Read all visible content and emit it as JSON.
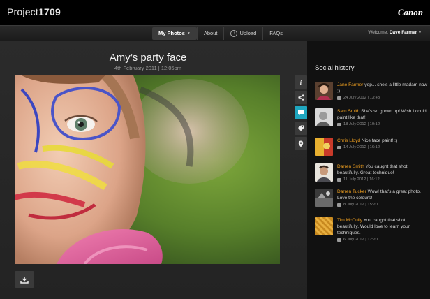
{
  "header": {
    "brand_prefix": "Project",
    "brand_number": "1709",
    "logo_text": "Canon"
  },
  "nav": {
    "items": [
      {
        "label": "My Photos",
        "active": true
      },
      {
        "label": "About"
      },
      {
        "label": "Upload"
      },
      {
        "label": "FAQs"
      }
    ],
    "welcome_prefix": "Welcome,",
    "user_name": "Dave Farmer"
  },
  "photo": {
    "title": "Amy’s party face",
    "date": "4th February 2011 | 12:05pm"
  },
  "tools": [
    "info-icon",
    "share-icon",
    "comment-icon",
    "tag-icon",
    "location-icon"
  ],
  "social": {
    "title": "Social history",
    "comments": [
      {
        "name": "Jane Farmer",
        "text": "yep... she's a little madam now ;)",
        "date": "24 July 2012 | 13:43"
      },
      {
        "name": "Sam Smith",
        "text": "She's so grown up! Wish I could paint like that!",
        "date": "18 July 2012 | 10:12"
      },
      {
        "name": "Chris Lloyd",
        "text": "Nice face paint! :)",
        "date": "14 July 2012 | 16:12"
      },
      {
        "name": "Darren Smith",
        "text": "You caught that shot beautifully. Great technique!",
        "date": "11 July 2012 | 16:12"
      },
      {
        "name": "Darren Tucker",
        "text": "Wow! that's a great photo. Love the colours!",
        "date": "8 July 2012 | 15:20"
      },
      {
        "name": "Tim McCully",
        "text": "You caught that shot beautifully. Would love to learn your techniques.",
        "date": "6 July 2012 | 12:20"
      }
    ]
  },
  "colors": {
    "accent_teal": "#1fa6bf",
    "name_orange": "#f0a020"
  }
}
